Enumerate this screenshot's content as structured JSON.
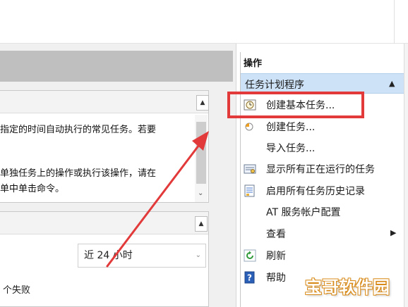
{
  "panel1": {
    "lines": [
      "指定的时间自动执行的常见任务。若要",
      "单独任务上的操作或执行该操作，请在",
      "单中单击命令。"
    ]
  },
  "panel2": {
    "dropdown_value": "近 24 小时",
    "fail_text": "个失败"
  },
  "actions": {
    "title": "操作",
    "section": "任务计划程序",
    "items": [
      {
        "label": "创建基本任务...",
        "icon": "calendar-clock-icon"
      },
      {
        "label": "创建任务...",
        "icon": "task-clock-icon"
      },
      {
        "label": "导入任务...",
        "icon": ""
      },
      {
        "label": "显示所有正在运行的任务",
        "icon": "running-tasks-icon"
      },
      {
        "label": "启用所有任务历史记录",
        "icon": "history-icon"
      },
      {
        "label": "AT 服务帐户配置",
        "icon": ""
      },
      {
        "label": "查看",
        "icon": "",
        "submenu": true
      },
      {
        "label": "刷新",
        "icon": "refresh-icon"
      },
      {
        "label": "帮助",
        "icon": "help-icon"
      }
    ]
  },
  "colors": {
    "highlight": "#e23a3a",
    "section_bg": "#cde2f6"
  },
  "watermark": "宝哥软件园"
}
